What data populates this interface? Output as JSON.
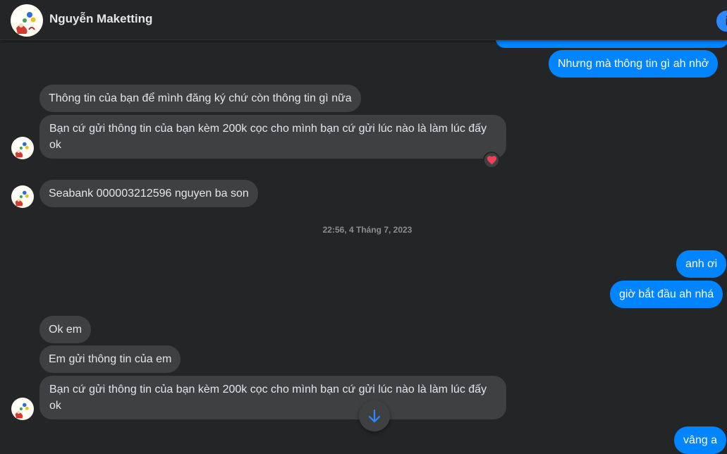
{
  "header": {
    "contact_name": "Nguyễn Maketting",
    "info_icon": "info-icon"
  },
  "messages": {
    "out_1": "Nhưng mà thông tin gì ah nhở",
    "in_1": "Thông tin của bạn để mình đăng ký chứ còn thông tin gì nữa",
    "in_2": "Bạn cứ gửi thông tin của bạn kèm 200k cọc cho mình bạn cứ gửi lúc nào là làm lúc đấy ok",
    "in_3": "Seabank 000003212596 nguyen ba son",
    "timestamp": "22:56, 4 Tháng 7, 2023",
    "out_2": "anh ơi",
    "out_3": "giờ bắt đầu ah nhá",
    "in_4": "Ok em",
    "in_5": "Em gửi thông tin của em",
    "in_6": "Bạn cứ gửi thông tin của bạn kèm 200k cọc cho mình bạn cứ gửi lúc nào là làm lúc đấy ok",
    "out_4": "vâng a"
  },
  "colors": {
    "background": "#242526",
    "incoming_bubble": "#3e4042",
    "outgoing_bubble": "#0084ff",
    "accent": "#2d88ff",
    "reaction": "#f33e58"
  },
  "icons": {
    "reaction": "heart-icon",
    "scroll": "arrow-down-icon"
  }
}
